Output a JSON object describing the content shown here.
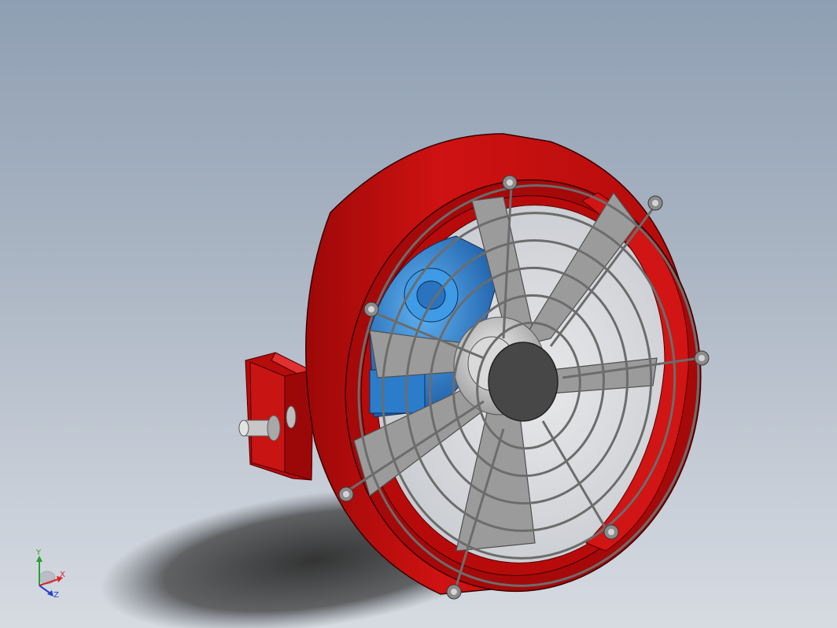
{
  "viewport": {
    "background_top": "#8f9fb3",
    "background_bottom": "#d6dbe2"
  },
  "model": {
    "description_icon": "axial-fan-assembly-icon",
    "colors": {
      "housing": "#c40d0d",
      "housing_dark": "#8c0606",
      "guard": "#6e6e6e",
      "blade": "#9a9a9a",
      "motor": "#2e86d6",
      "hub": "#454545",
      "shadow": "#2f2f2f"
    }
  },
  "triad": {
    "x_label": "X",
    "y_label": "Y",
    "z_label": "Z",
    "x_color": "#d8262b",
    "y_color": "#2aa12f",
    "z_color": "#2245c9"
  }
}
